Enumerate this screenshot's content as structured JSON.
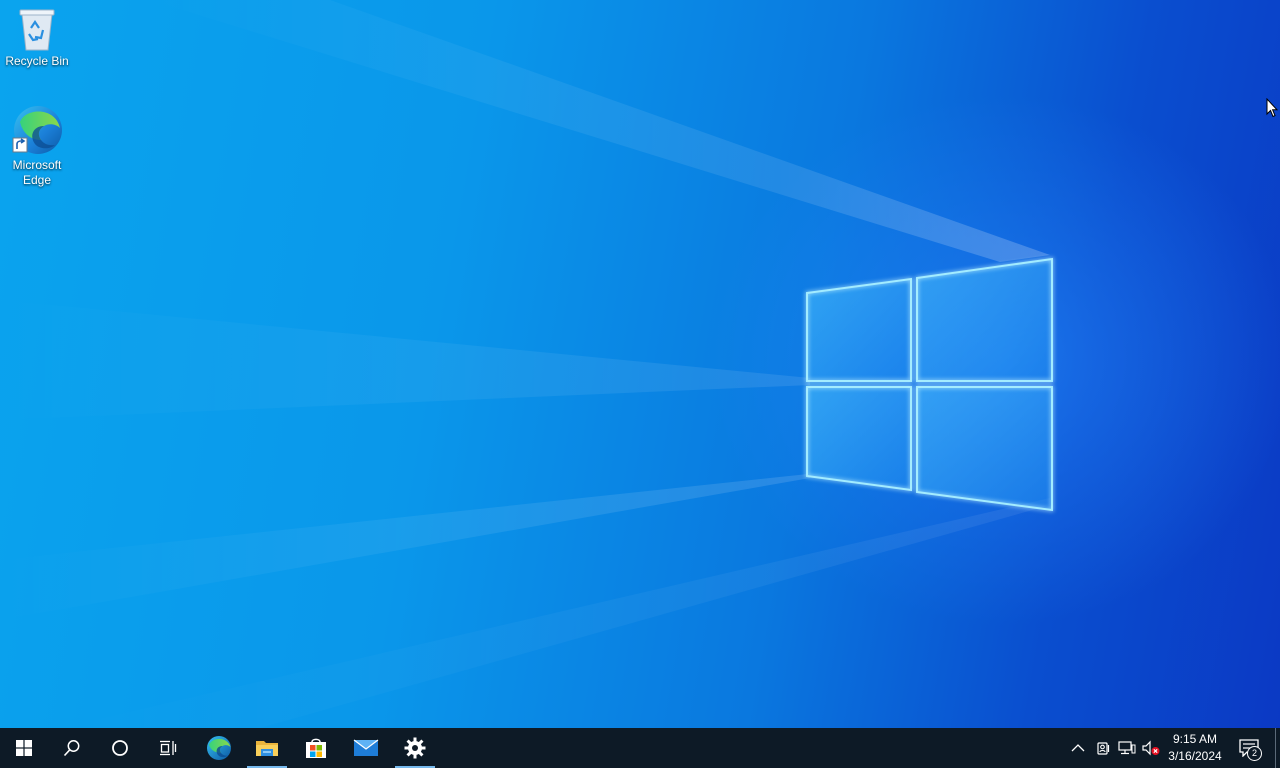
{
  "desktop": {
    "icons": [
      {
        "label": "Recycle Bin",
        "icon": "recycle-bin-icon"
      },
      {
        "label": "Microsoft Edge",
        "icon": "edge-icon",
        "shortcut": true
      }
    ]
  },
  "taskbar": {
    "buttons": [
      {
        "name": "start",
        "icon": "windows-logo-icon"
      },
      {
        "name": "search",
        "icon": "search-icon"
      },
      {
        "name": "cortana",
        "icon": "circle-icon"
      },
      {
        "name": "task-view",
        "icon": "task-view-icon"
      },
      {
        "name": "edge",
        "icon": "edge-icon"
      },
      {
        "name": "file-explorer",
        "icon": "folder-icon",
        "running": true
      },
      {
        "name": "microsoft-store",
        "icon": "store-icon"
      },
      {
        "name": "mail",
        "icon": "mail-icon"
      },
      {
        "name": "settings",
        "icon": "gear-icon",
        "running": true
      }
    ],
    "tray": {
      "icons": [
        "chevron-up-icon",
        "meet-now-icon",
        "network-icon",
        "volume-muted-icon"
      ],
      "time": "9:15 AM",
      "date": "3/16/2024",
      "notification_count": "2"
    }
  },
  "colors": {
    "taskbar": "#0d1a26",
    "accent": "#76b9ed",
    "wallpaper_light": "#0aa4ee",
    "wallpaper_dark": "#0b39c4"
  }
}
